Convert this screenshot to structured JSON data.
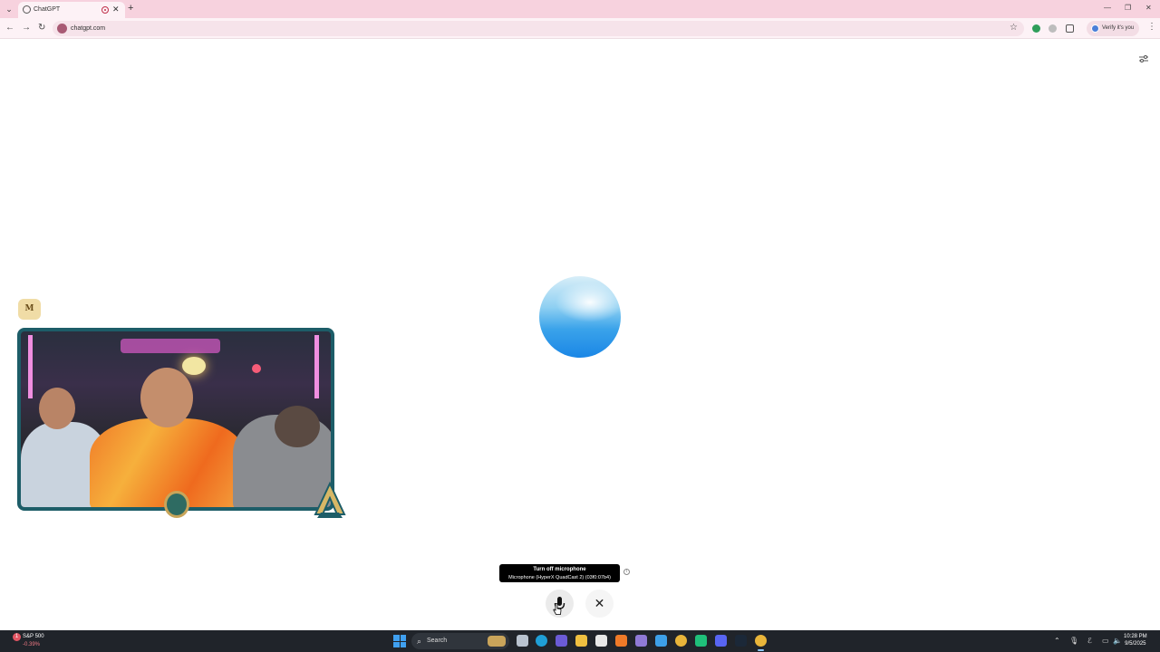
{
  "browser": {
    "tab_menu_icon": "chevron-down-icon",
    "tab_title": "ChatGPT",
    "tab_close_label": "✕",
    "new_tab_label": "+",
    "url": "chatgpt.com",
    "verify_label": "Verify it's you",
    "window_controls": {
      "minimize": "—",
      "restore": "❐",
      "close": "✕"
    }
  },
  "voice": {
    "tooltip_title": "Turn off microphone",
    "tooltip_device": "Microphone (HyperX QuadCast 2) (03f0:07b4)",
    "info_symbol": "i",
    "close_label": "✕"
  },
  "overlay": {
    "badge_text": "M"
  },
  "taskbar": {
    "stock_alert": "1",
    "stock_name": "S&P 500",
    "stock_change": "-0.39%",
    "search_placeholder": "Search",
    "clock_time": "10:28 PM",
    "clock_date": "9/5/2025"
  },
  "colors": {
    "tabstrip_bg": "#f7d2de",
    "toolbar_bg": "#fdf2f6",
    "orb_blue": "#1a86e6",
    "taskbar_bg": "#20242a"
  }
}
